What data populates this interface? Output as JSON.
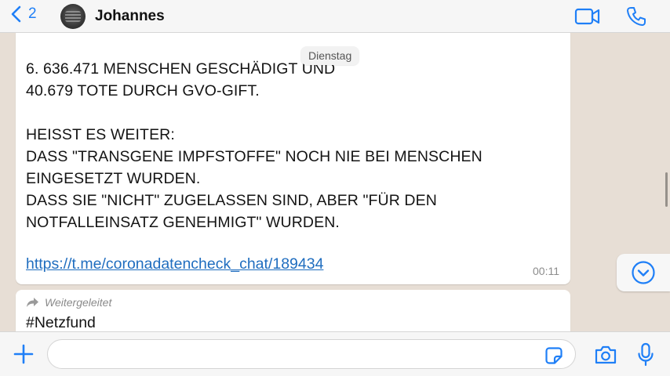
{
  "header": {
    "back_count": "2",
    "contact_name": "Johannes"
  },
  "chat": {
    "day_label": "Dienstag",
    "message1": {
      "text": "6. 636.471 MENSCHEN GESCHÄDIGT UND\n40.679 TOTE DURCH GVO-GIFT.\n\nHEISST ES WEITER:\nDASS \"TRANSGENE IMPFSTOFFE\" NOCH NIE BEI MENSCHEN\nEINGESETZT WURDEN.\nDASS SIE \"NICHT\" ZUGELASSEN SIND, ABER \"FÜR DEN\nNOTFALLEINSATZ GENEHMIGT\" WURDEN.",
      "link": "https://t.me/coronadatencheck_chat/189434",
      "time": "00:11"
    },
    "message2": {
      "forwarded_label": "Weitergeleitet",
      "text": "#Netzfund"
    }
  },
  "input": {
    "placeholder": "",
    "value": ""
  },
  "colors": {
    "accent": "#1f7ff7",
    "link": "#1f6dbf",
    "chat_background": "#e7ded5",
    "bubble": "#ffffff"
  },
  "icons": [
    "chevron-left-icon",
    "video-camera-icon",
    "phone-icon",
    "chevron-down-circle-icon",
    "forward-arrow-icon",
    "plus-icon",
    "sticker-icon",
    "camera-icon",
    "microphone-icon"
  ]
}
